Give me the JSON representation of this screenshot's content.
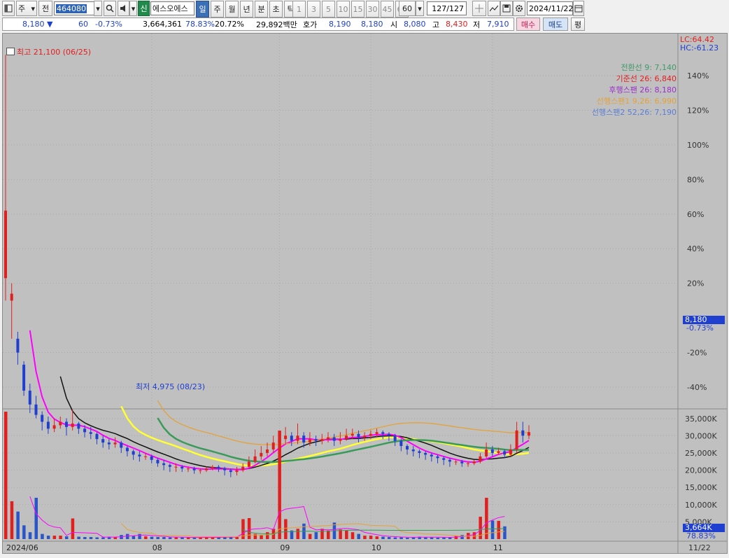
{
  "toolbar": {
    "market": "주",
    "code_type": "전",
    "code": "464080",
    "badge_new": "신",
    "name": "에스오에스",
    "periods": [
      "일",
      "주",
      "월",
      "년",
      "분",
      "초",
      "틱"
    ],
    "active_period": "일",
    "intervals": [
      "1",
      "3",
      "5",
      "10",
      "15",
      "30",
      "45",
      "60"
    ],
    "count_value": "60",
    "page_counter": "127/127",
    "date": "2024/11/22"
  },
  "quote": {
    "price": "8,180",
    "direction": "▼",
    "change": "60",
    "change_pct": "-0.73%",
    "volume": "3,664,361",
    "vol_ratio": "78.83%",
    "turnover": "20.72%",
    "amount": "29,892백만",
    "ask_label": "호가",
    "ask": "8,190",
    "bid": "8,180",
    "open_label": "시",
    "open": "8,080",
    "high_label": "고",
    "high": "8,430",
    "low_label": "저",
    "low": "7,910",
    "buy_button": "매수",
    "sell_button": "매도",
    "eval_button": "평"
  },
  "chart": {
    "lc": "LC:64.42",
    "hc": "HC:-61.23",
    "high_mark": "최고 21,100 (06/25)",
    "low_mark": "최저 4,975 (08/23)",
    "current_price_tag": "8,180",
    "current_pct_tag": "-0.73%",
    "legend": [
      {
        "label": "전환선 9: 7,140",
        "color": "#3f9a6a"
      },
      {
        "label": "기준선 26: 6,840",
        "color": "#e0201f"
      },
      {
        "label": "후행스팬 26: 8,180",
        "color": "#9b30c8"
      },
      {
        "label": "선행스팬1 9,26: 6,990",
        "color": "#e3a23a"
      },
      {
        "label": "선행스팬2 52,26: 7,190",
        "color": "#5a7fd6"
      }
    ],
    "price_ticks": [
      "140%",
      "120%",
      "100%",
      "80%",
      "60%",
      "40%",
      "20%",
      "-20%",
      "-40%"
    ],
    "volume_ticks": [
      "35,000K",
      "30,000K",
      "25,000K",
      "20,000K",
      "15,000K",
      "10,000K",
      "5,000K"
    ],
    "volume_tag": "3,664K",
    "volume_pct_tag": "78.83%",
    "x_labels": [
      "2024/06",
      "08",
      "09",
      "10",
      "11"
    ],
    "x_right_label": "11/22"
  },
  "chart_data": {
    "type": "candlestick",
    "candles": [
      [
        23,
        62,
        152,
        10
      ],
      [
        10,
        14,
        20,
        -12
      ],
      [
        -12,
        -20,
        -8,
        -27
      ],
      [
        -27,
        -42,
        -25,
        -45
      ],
      [
        -42,
        -50,
        -38,
        -55
      ],
      [
        -50,
        -56,
        -45,
        -58
      ],
      [
        -56,
        -60,
        -54,
        -65
      ],
      [
        -60,
        -64,
        -57,
        -67
      ],
      [
        -64,
        -62,
        -58,
        -66
      ],
      [
        -62,
        -60,
        -57,
        -64
      ],
      [
        -60,
        -63,
        -58,
        -68
      ],
      [
        -63,
        -61,
        -53,
        -65
      ],
      [
        -61,
        -64,
        -60,
        -67
      ],
      [
        -64,
        -66,
        -62,
        -69
      ],
      [
        -66,
        -67,
        -63,
        -70
      ],
      [
        -67,
        -70,
        -66,
        -73
      ],
      [
        -70,
        -72,
        -68,
        -75
      ],
      [
        -72,
        -73,
        -70,
        -76
      ],
      [
        -73,
        -72,
        -69,
        -75
      ],
      [
        -72,
        -75,
        -71,
        -78
      ],
      [
        -75,
        -77,
        -74,
        -80
      ],
      [
        -77,
        -79,
        -76,
        -82
      ],
      [
        -79,
        -80,
        -77,
        -83
      ],
      [
        -80,
        -80,
        -78,
        -82
      ],
      [
        -80,
        -82,
        -79,
        -84
      ],
      [
        -82,
        -84,
        -81,
        -86
      ],
      [
        -84,
        -85,
        -82,
        -88
      ],
      [
        -85,
        -86,
        -84,
        -89
      ],
      [
        -86,
        -86,
        -84,
        -89
      ],
      [
        -86,
        -87,
        -85,
        -89
      ],
      [
        -87,
        -87,
        -86,
        -89
      ],
      [
        -87,
        -88,
        -86,
        -90
      ],
      [
        -88,
        -88,
        -87,
        -90
      ],
      [
        -88,
        -87,
        -86,
        -89
      ],
      [
        -87,
        -86,
        -85,
        -88
      ],
      [
        -86,
        -87,
        -85,
        -89
      ],
      [
        -87,
        -88,
        -86,
        -91
      ],
      [
        -88,
        -89,
        -87,
        -92
      ],
      [
        -89,
        -88,
        -86,
        -91
      ],
      [
        -88,
        -86,
        -84,
        -89
      ],
      [
        -86,
        -83,
        -80,
        -87
      ],
      [
        -83,
        -80,
        -76,
        -84
      ],
      [
        -80,
        -78,
        -74,
        -82
      ],
      [
        -78,
        -76,
        -72,
        -80
      ],
      [
        -76,
        -72,
        -68,
        -78
      ],
      [
        -72,
        -70,
        -65,
        -75
      ],
      [
        -70,
        -68,
        -63,
        -73
      ],
      [
        -68,
        -71,
        -66,
        -74
      ],
      [
        -71,
        -68,
        -61,
        -73
      ],
      [
        -68,
        -72,
        -66,
        -75
      ],
      [
        -72,
        -70,
        -66,
        -74
      ],
      [
        -70,
        -71,
        -68,
        -74
      ],
      [
        -71,
        -70,
        -67,
        -73
      ],
      [
        -70,
        -69,
        -66,
        -72
      ],
      [
        -69,
        -71,
        -67,
        -74
      ],
      [
        -71,
        -70,
        -66,
        -73
      ],
      [
        -70,
        -68,
        -64,
        -71
      ],
      [
        -68,
        -67,
        -64,
        -70
      ],
      [
        -67,
        -69,
        -65,
        -72
      ],
      [
        -69,
        -68,
        -66,
        -71
      ],
      [
        -68,
        -67,
        -65,
        -70
      ],
      [
        -67,
        -66,
        -64,
        -69
      ],
      [
        -66,
        -67,
        -65,
        -70
      ],
      [
        -67,
        -68,
        -66,
        -71
      ],
      [
        -68,
        -71,
        -67,
        -74
      ],
      [
        -71,
        -74,
        -70,
        -77
      ],
      [
        -74,
        -76,
        -73,
        -79
      ],
      [
        -76,
        -77,
        -74,
        -80
      ],
      [
        -77,
        -78,
        -76,
        -81
      ],
      [
        -78,
        -79,
        -77,
        -82
      ],
      [
        -79,
        -80,
        -78,
        -83
      ],
      [
        -80,
        -81,
        -79,
        -84
      ],
      [
        -81,
        -82,
        -80,
        -85
      ],
      [
        -82,
        -83,
        -81,
        -86
      ],
      [
        -83,
        -83,
        -82,
        -85
      ],
      [
        -83,
        -84,
        -82,
        -86
      ],
      [
        -84,
        -84,
        -83,
        -86
      ],
      [
        -84,
        -83,
        -82,
        -85
      ],
      [
        -83,
        -80,
        -78,
        -84
      ],
      [
        -80,
        -76,
        -72,
        -81
      ],
      [
        -76,
        -78,
        -74,
        -80
      ],
      [
        -78,
        -77,
        -75,
        -79
      ],
      [
        -77,
        -79,
        -76,
        -81
      ],
      [
        -79,
        -76,
        -73,
        -80
      ],
      [
        -76,
        -65,
        -60,
        -78
      ],
      [
        -65,
        -68,
        -60,
        -72
      ],
      [
        -68,
        -66,
        -62,
        -70
      ]
    ],
    "volume": [
      37000,
      11000,
      8000,
      4000,
      2000,
      12000,
      1500,
      1000,
      1000,
      1000,
      800,
      6000,
      700,
      600,
      600,
      500,
      500,
      700,
      600,
      1200,
      1500,
      900,
      1500,
      800,
      700,
      600,
      600,
      500,
      500,
      500,
      500,
      400,
      500,
      600,
      500,
      500,
      600,
      700,
      600,
      5800,
      6100,
      1500,
      1200,
      2000,
      3000,
      31500,
      5800,
      2500,
      3000,
      4500,
      1500,
      2000,
      3000,
      2500,
      4800,
      2800,
      2500,
      2000,
      1500,
      1000,
      1000,
      800,
      700,
      600,
      500,
      500,
      400,
      600,
      700,
      500,
      500,
      400,
      500,
      600,
      900,
      1200,
      1800,
      2000,
      6500,
      12000,
      5400,
      5300,
      3700
    ]
  }
}
